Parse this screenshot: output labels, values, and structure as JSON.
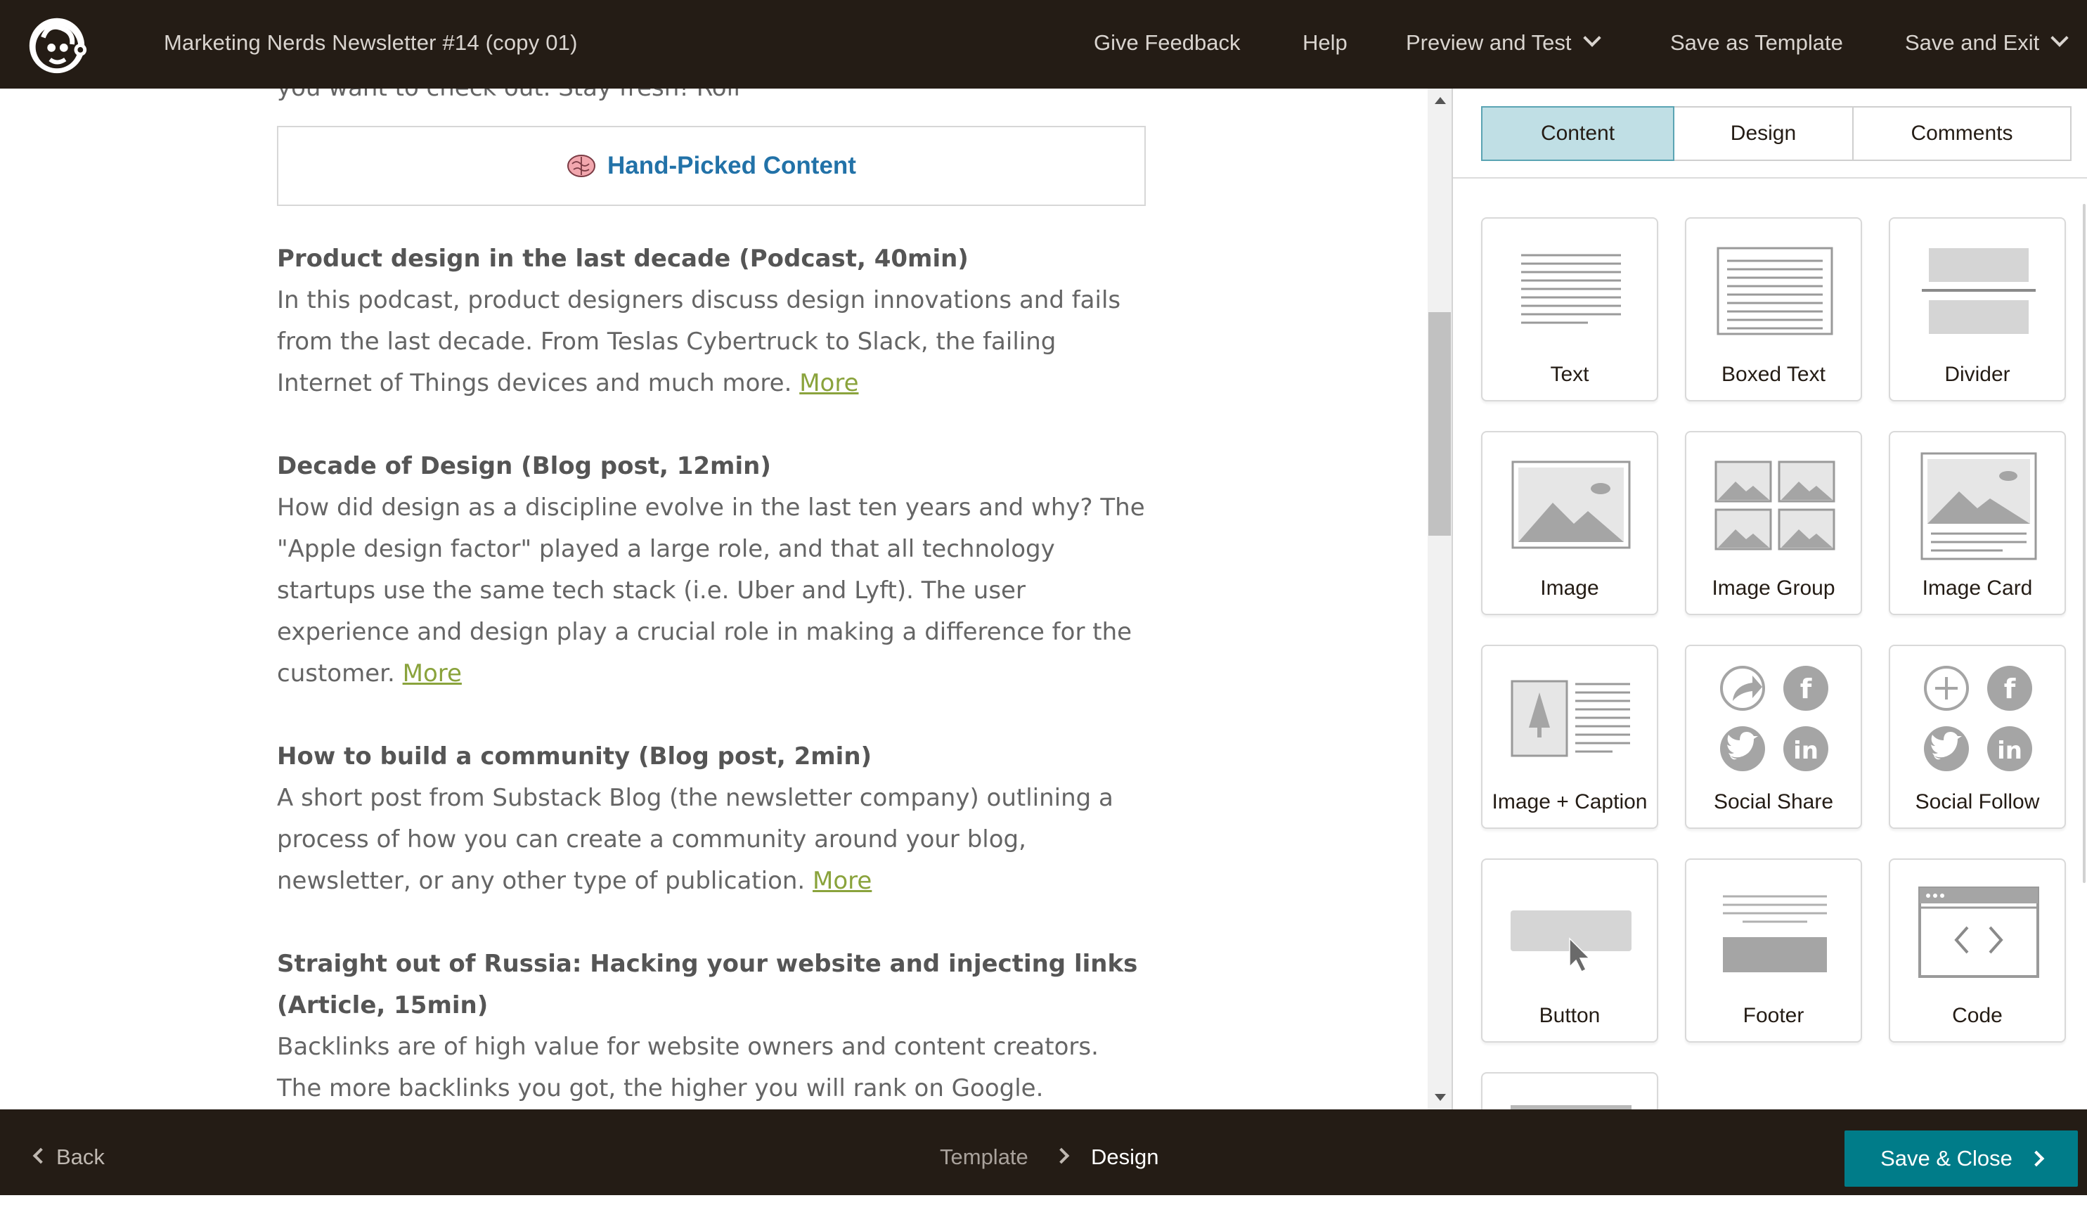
{
  "header": {
    "title": "Marketing Nerds Newsletter #14 (copy 01)",
    "nav": {
      "give_feedback": "Give Feedback",
      "help": "Help",
      "preview_and_test": "Preview and Test",
      "save_as_template": "Save as Template",
      "save_and_exit": "Save and Exit"
    }
  },
  "email": {
    "intro_tail": "you want to check out. Stay fresh! Rolf",
    "section_heading": "Hand-Picked Content",
    "articles": [
      {
        "title": "Product design in the last decade (Podcast, 40min)",
        "body": "In this podcast, product designers discuss design innovations and fails from the last decade. From Teslas Cybertruck to Slack, the failing Internet of Things devices and much more.",
        "link": "More"
      },
      {
        "title": "Decade of Design (Blog post, 12min)",
        "body": "How did design as a discipline evolve in the last ten years and why? The \"Apple design factor\" played a large role, and that all technology startups use the same tech stack (i.e. Uber and Lyft). The user experience and design play a crucial role in making a difference for the customer.",
        "link": "More"
      },
      {
        "title": "How to build a community (Blog post, 2min)",
        "body": "A short post from Substack Blog (the newsletter company) outlining a process of how you can create a community around your blog, newsletter, or any other type of publication.",
        "link": "More"
      },
      {
        "title": "Straight out of Russia: Hacking your website and injecting links (Article, 15min)",
        "body": "Backlinks are of high value for website owners and content creators. The more backlinks you got, the higher you will rank on Google. WordPress is a great target for hackers to inject those links, without the webmasters taking",
        "link": ""
      }
    ]
  },
  "panel": {
    "tabs": [
      "Content",
      "Design",
      "Comments"
    ],
    "active_tab": "Content",
    "blocks": [
      {
        "label": "Text",
        "icon": "text-block-icon"
      },
      {
        "label": "Boxed Text",
        "icon": "boxed-text-block-icon"
      },
      {
        "label": "Divider",
        "icon": "divider-block-icon"
      },
      {
        "label": "Image",
        "icon": "image-block-icon"
      },
      {
        "label": "Image Group",
        "icon": "image-group-block-icon"
      },
      {
        "label": "Image Card",
        "icon": "image-card-block-icon"
      },
      {
        "label": "Image + Caption",
        "icon": "image-caption-block-icon"
      },
      {
        "label": "Social Share",
        "icon": "social-share-block-icon"
      },
      {
        "label": "Social Follow",
        "icon": "social-follow-block-icon"
      },
      {
        "label": "Button",
        "icon": "button-block-icon"
      },
      {
        "label": "Footer",
        "icon": "footer-block-icon"
      },
      {
        "label": "Code",
        "icon": "code-block-icon"
      }
    ]
  },
  "footer": {
    "back": "Back",
    "breadcrumb": [
      "Template",
      "Design"
    ],
    "save_close": "Save & Close"
  },
  "colors": {
    "bar_bg": "#241c15",
    "accent_teal": "#007c89",
    "active_tab": "#c0dfe5",
    "link_green": "#8aa33c",
    "heading_blue": "#2272a8"
  }
}
